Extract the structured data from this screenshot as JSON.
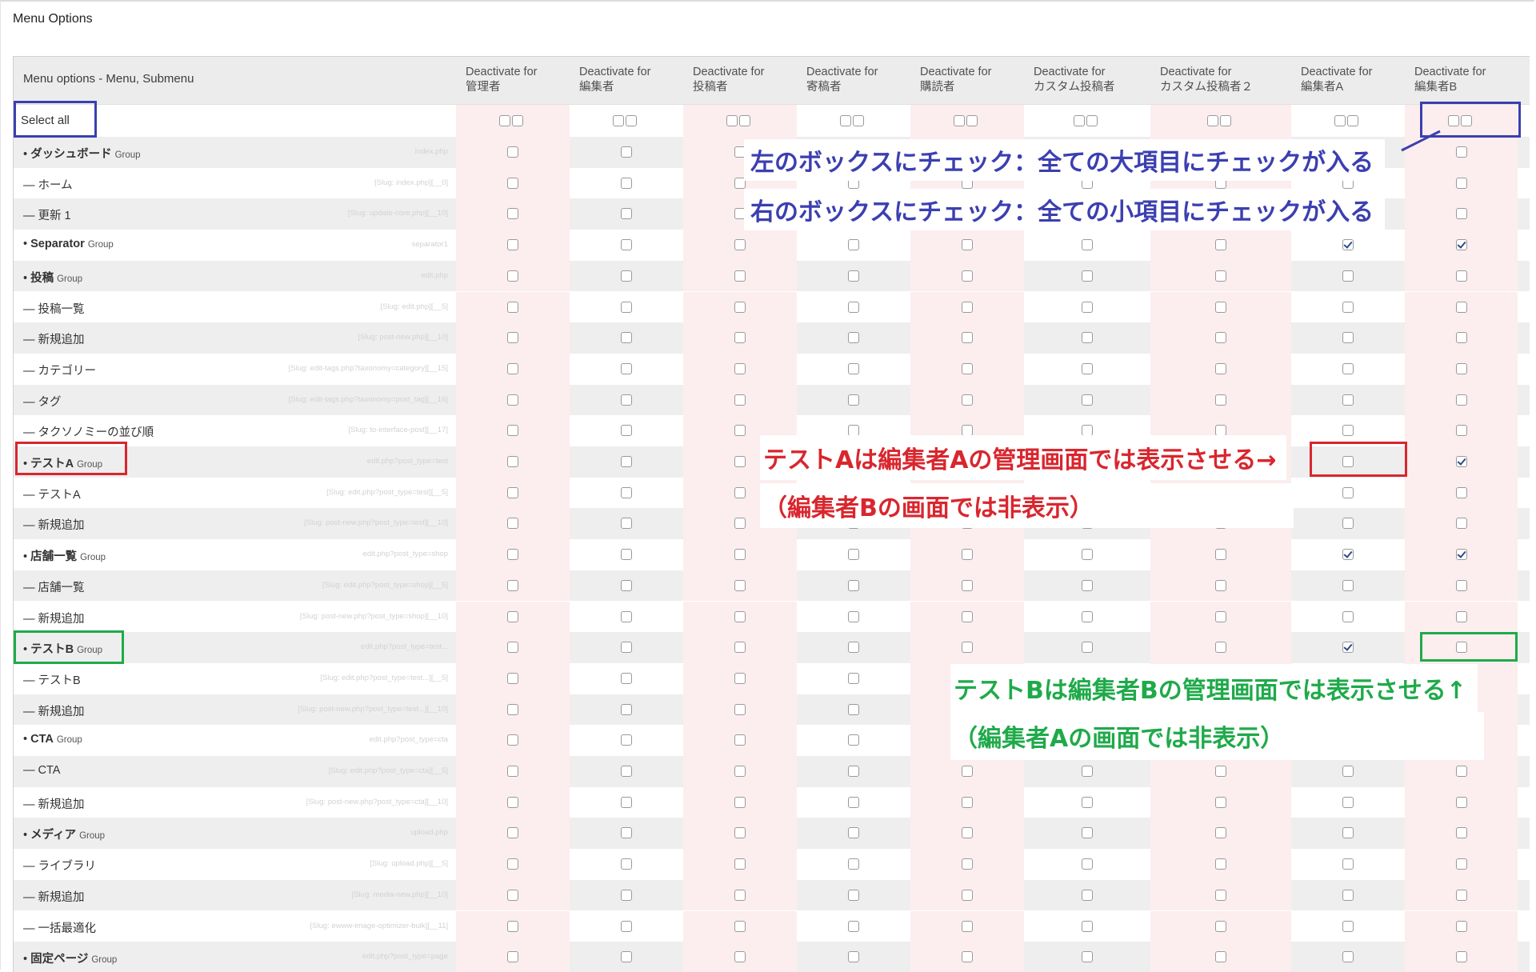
{
  "page": {
    "heading": "Menu Options"
  },
  "table": {
    "first_header": "Menu options - Menu, Submenu",
    "columns": [
      {
        "line1": "Deactivate for",
        "line2": "管理者"
      },
      {
        "line1": "Deactivate for",
        "line2": "編集者"
      },
      {
        "line1": "Deactivate for",
        "line2": "投稿者"
      },
      {
        "line1": "Deactivate for",
        "line2": "寄稿者"
      },
      {
        "line1": "Deactivate for",
        "line2": "購読者"
      },
      {
        "line1": "Deactivate for",
        "line2": "カスタム投稿者"
      },
      {
        "line1": "Deactivate for",
        "line2": "カスタム投稿者２"
      },
      {
        "line1": "Deactivate for",
        "line2": "編集者A"
      },
      {
        "line1": "Deactivate for",
        "line2": "編集者B"
      }
    ],
    "select_all_label": "Select all",
    "rows": [
      {
        "label": "ダッシュボード",
        "group": true,
        "slug": "index.php",
        "checked": []
      },
      {
        "label": "ホーム",
        "group": false,
        "slug": "[Slug: index.php][__0]",
        "checked": []
      },
      {
        "label": "更新 1",
        "group": false,
        "slug": "[Slug: update-core.php][__10]",
        "checked": []
      },
      {
        "label": "Separator",
        "group": true,
        "slug": "separator1",
        "checked": [
          7,
          8
        ]
      },
      {
        "label": "投稿",
        "group": true,
        "slug": "edit.php",
        "checked": []
      },
      {
        "label": "投稿一覧",
        "group": false,
        "slug": "[Slug: edit.php][__5]",
        "checked": []
      },
      {
        "label": "新規追加",
        "group": false,
        "slug": "[Slug: post-new.php][__10]",
        "checked": []
      },
      {
        "label": "カテゴリー",
        "group": false,
        "slug": "[Slug: edit-tags.php?taxonomy=category][__15]",
        "checked": []
      },
      {
        "label": "タグ",
        "group": false,
        "slug": "[Slug: edit-tags.php?taxonomy=post_tag][__16]",
        "checked": []
      },
      {
        "label": "タクソノミーの並び順",
        "group": false,
        "slug": "[Slug: to-interface-post][__17]",
        "checked": []
      },
      {
        "label": "テストA",
        "group": true,
        "slug": "edit.php?post_type=test",
        "checked": [
          8
        ]
      },
      {
        "label": "テストA",
        "group": false,
        "slug": "[Slug: edit.php?post_type=test][__5]",
        "checked": []
      },
      {
        "label": "新規追加",
        "group": false,
        "slug": "[Slug: post-new.php?post_type=test][__10]",
        "checked": []
      },
      {
        "label": "店舗一覧",
        "group": true,
        "slug": "edit.php?post_type=shop",
        "checked": [
          7,
          8
        ]
      },
      {
        "label": "店舗一覧",
        "group": false,
        "slug": "[Slug: edit.php?post_type=shop][__5]",
        "checked": []
      },
      {
        "label": "新規追加",
        "group": false,
        "slug": "[Slug: post-new.php?post_type=shop][__10]",
        "checked": []
      },
      {
        "label": "テストB",
        "group": true,
        "slug": "edit.php?post_type=test...",
        "checked": [
          7
        ]
      },
      {
        "label": "テストB",
        "group": false,
        "slug": "[Slug: edit.php?post_type=test...][__5]",
        "checked": []
      },
      {
        "label": "新規追加",
        "group": false,
        "slug": "[Slug: post-new.php?post_type=test...][__10]",
        "checked": []
      },
      {
        "label": "CTA",
        "group": true,
        "slug": "edit.php?post_type=cta",
        "checked": []
      },
      {
        "label": "CTA",
        "group": false,
        "slug": "[Slug: edit.php?post_type=cta][__5]",
        "checked": []
      },
      {
        "label": "新規追加",
        "group": false,
        "slug": "[Slug: post-new.php?post_type=cta][__10]",
        "checked": []
      },
      {
        "label": "メディア",
        "group": true,
        "slug": "upload.php",
        "checked": []
      },
      {
        "label": "ライブラリ",
        "group": false,
        "slug": "[Slug: upload.php][__5]",
        "checked": []
      },
      {
        "label": "新規追加",
        "group": false,
        "slug": "[Slug: media-new.php][__10]",
        "checked": []
      },
      {
        "label": "一括最適化",
        "group": false,
        "slug": "[Slug: ewww-image-optimizer-bulk][__11]",
        "checked": []
      },
      {
        "label": "固定ページ",
        "group": true,
        "slug": "edit.php?post_type=page",
        "checked": []
      }
    ],
    "group_tag": "Group",
    "sub_prefix": "— ",
    "group_prefix": "• "
  },
  "annotations": {
    "blue_line1": "左のボックスにチェック：全ての大項目にチェックが入る",
    "blue_line2": "右のボックスにチェック：全ての小項目にチェックが入る",
    "red_line1": "テストAは編集者Aの管理画面では表示させる→",
    "red_line2": "（編集者Bの画面では非表示）",
    "green_line1": "テストBは編集者Bの管理画面では表示させる↑",
    "green_line2": "（編集者Aの画面では非表示）",
    "colors": {
      "blue": "#3b3fb0",
      "red": "#d9262e",
      "green": "#1faa4a"
    }
  },
  "colors": {
    "header_bg": "#ececec",
    "row_gray": "#eeeeee",
    "row_white": "#ffffff",
    "col_pink": "#fceeee"
  }
}
